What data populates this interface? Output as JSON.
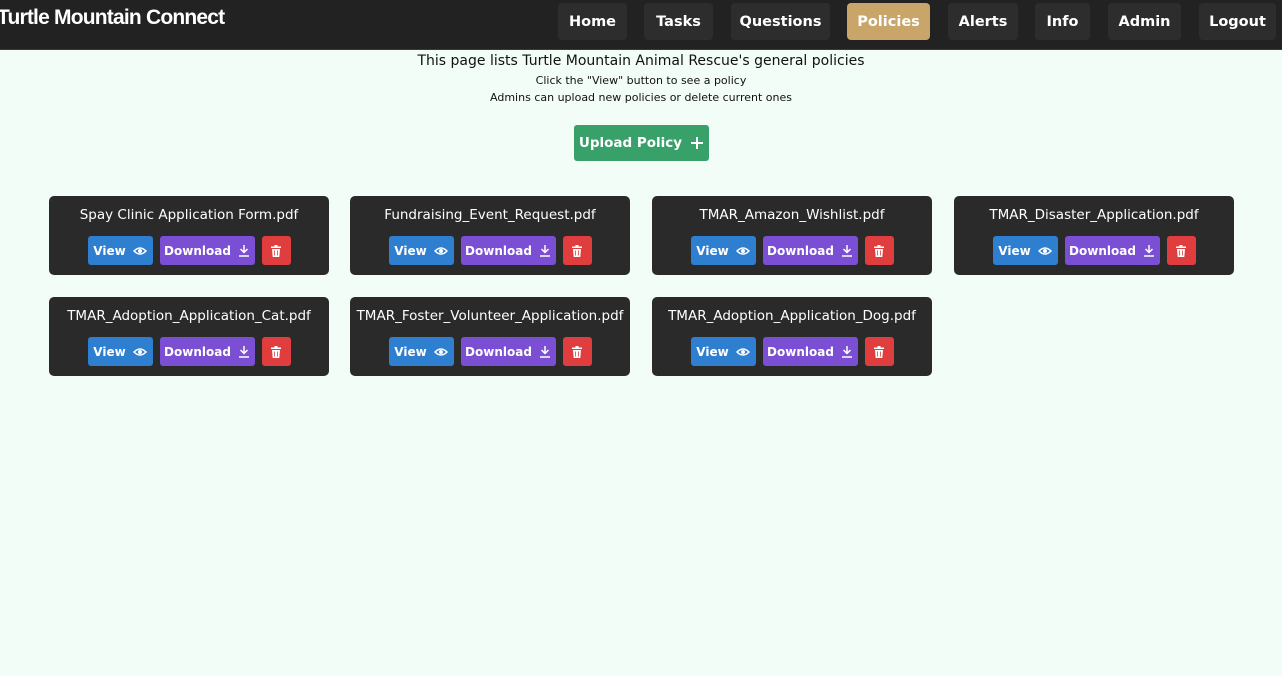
{
  "nav": {
    "brand": "Turtle Mountain Connect",
    "items": [
      {
        "label": "Home",
        "name": "nav-home-button",
        "active": false
      },
      {
        "label": "Tasks",
        "name": "nav-tasks-button",
        "active": false
      },
      {
        "label": "Questions",
        "name": "nav-questions-button",
        "active": false
      },
      {
        "label": "Policies",
        "name": "nav-policies-button",
        "active": true
      },
      {
        "label": "Alerts",
        "name": "nav-alerts-button",
        "active": false
      },
      {
        "label": "Info",
        "name": "nav-info-button",
        "active": false
      },
      {
        "label": "Admin",
        "name": "nav-admin-button",
        "active": false
      },
      {
        "label": "Logout",
        "name": "nav-logout-button",
        "active": false
      }
    ]
  },
  "intro": {
    "main": "This page lists Turtle Mountain Animal Rescue's general policies",
    "line1": "Click the \"View\" button to see a policy",
    "line2": "Admins can upload new policies or delete current ones"
  },
  "upload": {
    "label": "Upload Policy",
    "icon": "plus-icon"
  },
  "buttons": {
    "view_label": "View",
    "download_label": "Download",
    "view_icon": "eye-icon",
    "download_icon": "download-icon",
    "delete_icon": "trash-icon"
  },
  "policies": [
    {
      "filename": "Spay Clinic Application Form.pdf"
    },
    {
      "filename": "Fundraising_Event_Request.pdf"
    },
    {
      "filename": "TMAR_Amazon_Wishlist.pdf"
    },
    {
      "filename": "TMAR_Disaster_Application.pdf"
    },
    {
      "filename": "TMAR_Adoption_Application_Cat.pdf"
    },
    {
      "filename": "TMAR_Foster_Volunteer_Application.pdf"
    },
    {
      "filename": "TMAR_Adoption_Application_Dog.pdf"
    }
  ],
  "colors": {
    "page_bg": "#f3fdf7",
    "navbar_bg": "#222222",
    "nav_active": "#c9a56a",
    "upload_green": "#38a169",
    "view_blue": "#2f7fd0",
    "download_purple": "#7b4fd3",
    "delete_red": "#e03e3e",
    "card_bg": "#2a2a2a"
  }
}
